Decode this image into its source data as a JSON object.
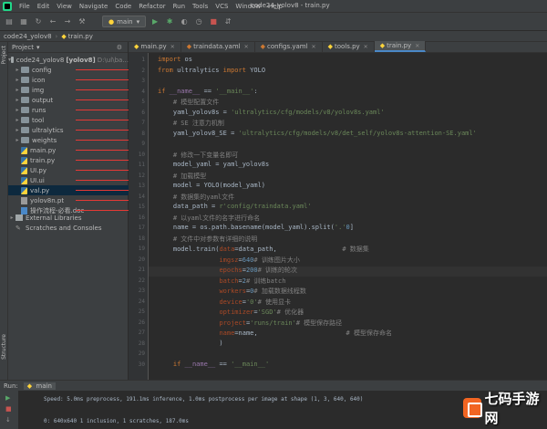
{
  "menubar": {
    "items": [
      "File",
      "Edit",
      "View",
      "Navigate",
      "Code",
      "Refactor",
      "Run",
      "Tools",
      "VCS",
      "Window",
      "Help"
    ],
    "window_title": "code24_yolov8 - train.py"
  },
  "toolbar": {
    "run_config": "main"
  },
  "breadcrumb": {
    "project": "code24_yolov8",
    "file": "train.py"
  },
  "side_strip": {
    "project_label": "Project",
    "structure_label": "Structure",
    "bookmarks_label": "Bookmarks"
  },
  "project_panel": {
    "header": "Project",
    "root": {
      "name": "code24_yolov8",
      "suffix": "[yolov8]",
      "path": "D:\\ul\\ba..."
    },
    "items": [
      {
        "name": "config",
        "type": "folder",
        "annotation": "配置文件"
      },
      {
        "name": "icon",
        "type": "folder",
        "annotation": "图标文件"
      },
      {
        "name": "img",
        "type": "folder",
        "annotation": "测试用的图片"
      },
      {
        "name": "output",
        "type": "folder",
        "annotation": "测试结果存放"
      },
      {
        "name": "runs",
        "type": "folder",
        "annotation": "训练结果"
      },
      {
        "name": "tool",
        "type": "folder",
        "annotation": "工具代码"
      },
      {
        "name": "ultralytics",
        "type": "folder",
        "annotation": "yolov8官方代码"
      },
      {
        "name": "weights",
        "type": "folder",
        "annotation": "训练好的模型权重"
      },
      {
        "name": "main.py",
        "type": "py",
        "annotation": "主程序代码"
      },
      {
        "name": "train.py",
        "type": "py",
        "annotation": "训练代码"
      },
      {
        "name": "UI.py",
        "type": "py",
        "annotation": "界面代码"
      },
      {
        "name": "UI.ui",
        "type": "py",
        "annotation": "界面文件，使用designer编辑"
      },
      {
        "name": "val.py",
        "type": "py",
        "annotation": "验证代码"
      },
      {
        "name": "yolov8n.pt",
        "type": "pt",
        "annotation": "预训练权重"
      },
      {
        "name": "操作流程-必看.doc",
        "type": "doc",
        "annotation": "说明文档"
      }
    ],
    "external_libraries": "External Libraries",
    "scratches": "Scratches and Consoles"
  },
  "editor": {
    "tabs": [
      {
        "label": "main.py"
      },
      {
        "label": "traindata.yaml"
      },
      {
        "label": "configs.yaml"
      },
      {
        "label": "tools.py"
      },
      {
        "label": "train.py",
        "active": true
      }
    ],
    "current_line": 21,
    "lines": [
      {
        "n": "1",
        "parts": [
          [
            "kw",
            "import "
          ],
          [
            "",
            "os"
          ]
        ]
      },
      {
        "n": "2",
        "parts": [
          [
            "kw",
            "from "
          ],
          [
            "",
            "ultralytics "
          ],
          [
            "kw",
            "import "
          ],
          [
            "",
            "YOLO"
          ]
        ]
      },
      {
        "n": "3",
        "parts": []
      },
      {
        "n": "4",
        "parts": [
          [
            "kw",
            "if "
          ],
          [
            "mag",
            "__name__"
          ],
          [
            "",
            " == "
          ],
          [
            "str",
            "'__main__'"
          ],
          [
            "",
            ":"
          ]
        ]
      },
      {
        "n": "5",
        "parts": [
          [
            "cmt",
            "    # 模型配置文件"
          ]
        ]
      },
      {
        "n": "6",
        "parts": [
          [
            "",
            "    yaml_yolov8s = "
          ],
          [
            "str",
            "'ultralytics/cfg/models/v8/yolov8s.yaml'"
          ]
        ]
      },
      {
        "n": "7",
        "parts": [
          [
            "cmt",
            "    # SE 注意力机制"
          ]
        ]
      },
      {
        "n": "8",
        "parts": [
          [
            "",
            "    yaml_yolov8_SE = "
          ],
          [
            "str",
            "'ultralytics/cfg/models/v8/det_self/yolov8s-attention-SE.yaml'"
          ]
        ]
      },
      {
        "n": "9",
        "parts": []
      },
      {
        "n": "10",
        "parts": [
          [
            "cmt",
            "    # 修改一下变量名即可"
          ]
        ]
      },
      {
        "n": "11",
        "parts": [
          [
            "",
            "    model_yaml = yaml_yolov8s"
          ]
        ]
      },
      {
        "n": "12",
        "parts": [
          [
            "cmt",
            "    # 加载模型"
          ]
        ]
      },
      {
        "n": "13",
        "parts": [
          [
            "",
            "    model = YOLO(model_yaml)"
          ]
        ]
      },
      {
        "n": "14",
        "parts": [
          [
            "cmt",
            "    # 数据集的yaml文件"
          ]
        ]
      },
      {
        "n": "15",
        "parts": [
          [
            "",
            "    data_path = "
          ],
          [
            "str",
            "r'config/traindata.yaml'"
          ]
        ]
      },
      {
        "n": "16",
        "parts": [
          [
            "cmt",
            "    # 以yaml文件的名字进行命名"
          ]
        ]
      },
      {
        "n": "17",
        "parts": [
          [
            "",
            "    name = os.path.basename(model_yaml).split("
          ],
          [
            "str",
            "'.'"
          ],
          [
            ")["
          ],
          [
            "num",
            "0"
          ],
          [
            "",
            "]"
          ]
        ]
      },
      {
        "n": "18",
        "parts": [
          [
            "cmt",
            "    # 文件中对参数有详细的说明"
          ]
        ]
      },
      {
        "n": "19",
        "parts": [
          [
            "",
            "    model.train("
          ],
          [
            "par",
            "data"
          ],
          [
            "",
            "=data_path,                 "
          ],
          [
            "cmt",
            "# 数据集"
          ]
        ]
      },
      {
        "n": "20",
        "parts": [
          [
            "",
            "                "
          ],
          [
            "par",
            "imgsz"
          ],
          [
            "",
            "="
          ],
          [
            "num",
            "640"
          ],
          [
            ",                       "
          ],
          [
            "cmt",
            "# 训练图片大小"
          ]
        ]
      },
      {
        "n": "21",
        "parts": [
          [
            "",
            "                "
          ],
          [
            "par",
            "epochs"
          ],
          [
            "",
            "="
          ],
          [
            "num",
            "200"
          ],
          [
            ",                      "
          ],
          [
            "cmt",
            "# 训练的轮次"
          ]
        ]
      },
      {
        "n": "22",
        "parts": [
          [
            "",
            "                "
          ],
          [
            "par",
            "batch"
          ],
          [
            "",
            "="
          ],
          [
            "num",
            "2"
          ],
          [
            ",                         "
          ],
          [
            "cmt",
            "# 训练batch"
          ]
        ]
      },
      {
        "n": "23",
        "parts": [
          [
            "",
            "                "
          ],
          [
            "par",
            "workers"
          ],
          [
            "",
            "="
          ],
          [
            "num",
            "0"
          ],
          [
            ",                       "
          ],
          [
            "cmt",
            "# 加载数据线程数"
          ]
        ]
      },
      {
        "n": "24",
        "parts": [
          [
            "",
            "                "
          ],
          [
            "par",
            "device"
          ],
          [
            "",
            "="
          ],
          [
            "str",
            "'0'"
          ],
          [
            ",                      "
          ],
          [
            "cmt",
            "# 使用显卡"
          ]
        ]
      },
      {
        "n": "25",
        "parts": [
          [
            "",
            "                "
          ],
          [
            "par",
            "optimizer"
          ],
          [
            "",
            "="
          ],
          [
            "str",
            "'SGD'"
          ],
          [
            ",                 "
          ],
          [
            "cmt",
            "# 优化器"
          ]
        ]
      },
      {
        "n": "26",
        "parts": [
          [
            "",
            "                "
          ],
          [
            "par",
            "project"
          ],
          [
            "",
            "="
          ],
          [
            "str",
            "'runs/train'"
          ],
          [
            ",            "
          ],
          [
            "cmt",
            "# 模型保存路径"
          ]
        ]
      },
      {
        "n": "27",
        "parts": [
          [
            "",
            "                "
          ],
          [
            "par",
            "name"
          ],
          [
            "",
            "=name,                       "
          ],
          [
            "cmt",
            "# 模型保存命名"
          ]
        ]
      },
      {
        "n": "28",
        "parts": [
          [
            "",
            "                )"
          ]
        ]
      },
      {
        "n": "29",
        "parts": []
      },
      {
        "n": "30",
        "parts": [
          [
            "",
            "    "
          ],
          [
            "kw",
            "if "
          ],
          [
            "mag",
            "__name__"
          ],
          [
            "",
            " == "
          ],
          [
            "str",
            "'__main__'"
          ]
        ]
      }
    ]
  },
  "run": {
    "label": "Run:",
    "tab": "main",
    "console": [
      "Speed: 5.0ms preprocess, 191.1ms inference, 1.0ms postprocess per image at shape (1, 3, 640, 640)",
      "",
      "0: 640x640 1 inclusion, 1 scratches, 187.0ms"
    ]
  },
  "watermark": {
    "text": "七码手游网"
  }
}
